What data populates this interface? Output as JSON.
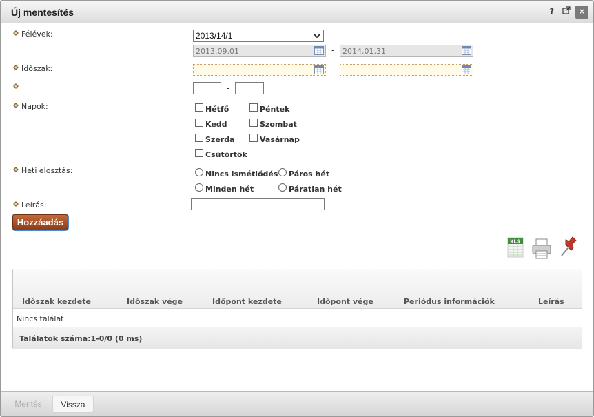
{
  "window": {
    "title": "Új mentesítés",
    "help_label": "?",
    "close_label": "✕"
  },
  "form": {
    "semester_label": "Félévek:",
    "semester_value": "2013/14/1",
    "semester_start": "2013.09.01",
    "semester_end": "2014.01.31",
    "period_label": "Időszak:",
    "period_start": "",
    "period_end": "",
    "time_label": "",
    "time_from": "",
    "time_to": "",
    "dash": "-",
    "days_label": "Napok:",
    "days": [
      "Hétfő",
      "Péntek",
      "Kedd",
      "Szombat",
      "Szerda",
      "Vasárnap",
      "Csütörtök"
    ],
    "weekly_label": "Heti elosztás:",
    "weekly_options": [
      "Nincs ismétlődés",
      "Páros hét",
      "Minden hét",
      "Páratlan hét"
    ],
    "description_label": "Leírás:",
    "description_value": "",
    "add_button": "Hozzáadás"
  },
  "toolbar": {
    "icons": [
      "excel-export-icon",
      "print-icon",
      "pin-icon"
    ],
    "xls_text": "XLS"
  },
  "table": {
    "columns": [
      "Időszak kezdete",
      "Időszak vége",
      "Időpont kezdete",
      "Időpont vége",
      "Periódus információk",
      "Leírás"
    ],
    "empty_text": "Nincs találat",
    "count_text": "Találatok száma:1-0/0 (0 ms)"
  },
  "footer": {
    "save_label": "Mentés",
    "back_label": "Vissza"
  },
  "colors": {
    "add_button": "#a64e24",
    "required_field": "#fffbe6",
    "disabled_field": "#e6e6e6"
  }
}
